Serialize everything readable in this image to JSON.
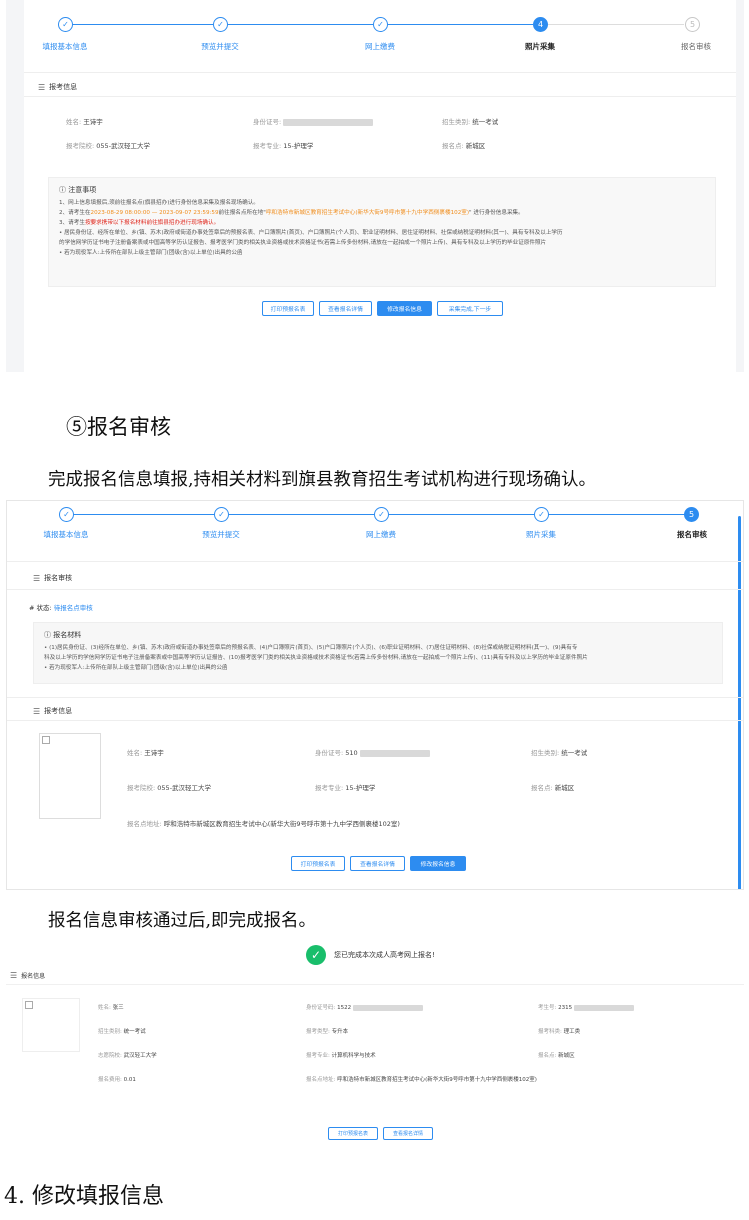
{
  "panel1": {
    "steps": [
      {
        "label": "填报基本信息",
        "state": "done"
      },
      {
        "label": "预览并提交",
        "state": "done"
      },
      {
        "label": "网上缴费",
        "state": "done"
      },
      {
        "label": "照片采集",
        "state": "active",
        "num": "4"
      },
      {
        "label": "报名审核",
        "state": "todo",
        "num": "5"
      }
    ],
    "section_title": "报考信息",
    "fields": {
      "name_label": "姓名:",
      "name_value": "王诗宇",
      "id_label": "身份证号:",
      "type_label": "招生类别:",
      "type_value": "统一考试",
      "school_label": "报考院校:",
      "school_value": "055-武汉轻工大学",
      "major_label": "报考专业:",
      "major_value": "15-护理学",
      "site_label": "报名点:",
      "site_value": "新城区"
    },
    "notice": {
      "title": "注意事项",
      "l1": "1、网上信息填报后,须前往报名点(旗县招办)进行身份信息采集及报名现场确认。",
      "l2a": "2、请考生在",
      "l2_time": "2023-08-29 08:00:00 — 2023-09-07 23:59:59",
      "l2b": "前往报名点所在地\"",
      "l2_place": "呼和浩特市新城区教育招生考试中心(新华大街9号呼市第十九中学西侧裹楼102室)",
      "l2c": "\" 进行身份信息采集。",
      "l3a": "3、请考生",
      "l3_red": "按要求携带以下报名材料前往旗县招办进行现场确认。",
      "l4": "• 居民身份证、经所在单位、乡(镇、苏木)政府或街道办事处签章后的预报名表、户口簿照片(首页)、户口簿照片(个人页)、职业证明材料、居住证明材料、社保或纳税证明材料(其一)、具有专科及以上学历",
      "l5": "的学信网学历证书电子注册备案表或中国高等学历认证报告、报考医学门类的相关执业资格或技术资格证书(若需上传多份材料,请放在一起拍成一个照片上传)、具有专科及以上学历的毕业证原件照片",
      "l6": "• 若为现役军人:上传所在部队上级主管部门(团级(含)以上单位)出具的公函"
    },
    "buttons": [
      "打印预报名表",
      "查看报名详情",
      "修改报名信息",
      "采集完成,下一步"
    ]
  },
  "doc": {
    "h5": "⑤报名审核",
    "p1": "完成报名信息填报,持相关材料到旗县教育招生考试机构进行现场确认。",
    "p2": "报名信息审核通过后,即完成报名。",
    "h4": "4. 修改填报信息"
  },
  "panel2": {
    "steps": [
      {
        "label": "填报基本信息"
      },
      {
        "label": "预览并提交"
      },
      {
        "label": "网上缴费"
      },
      {
        "label": "照片采集"
      },
      {
        "label": "报名审核",
        "num": "5"
      }
    ],
    "audit_title": "报名审核",
    "status_label": "# 状态:",
    "status_value": "待报名点审核",
    "materials_title": "报名材料",
    "m1": "• (1)居民身份证、(3)经所在单位、乡(镇、苏木)政府或街道办事处签章后的预报名表、(4)户口簿照片(首页)、(5)户口簿照片(个人页)、(6)职业证明材料、(7)居住证明材料、(8)社保或纳税证明材料(其一)、(9)具有专",
    "m2": "科及以上学历的学信网学历证书电子注册备案表或中国高等学历认证报告、(10)报考医学门类的相关执业资格或技术资格证书(若需上传多份材料,请放在一起拍成一个照片上传)、(11)具有专科及以上学历的毕业证原件照片",
    "m3": "• 若为现役军人:上传所在部队上级主管部门(团级(含)以上单位)出具的公函",
    "info_title": "报考信息",
    "name_label": "姓名:",
    "name_value": "王诗宇",
    "id_label": "身份证号:",
    "id_value": "510",
    "type_label": "招生类别:",
    "type_value": "统一考试",
    "school_label": "报考院校:",
    "school_value": "055-武汉轻工大学",
    "major_label": "报考专业:",
    "major_value": "15-护理学",
    "site_label": "报名点:",
    "site_value": "新城区",
    "addr_label": "报名点地址:",
    "addr_value": "呼和浩特市新城区教育招生考试中心(新华大街9号呼市第十九中学西侧裹楼102室)",
    "buttons": [
      "打印预报名表",
      "查看报名详情",
      "修改报名信息"
    ]
  },
  "panel3": {
    "success": "您已完成本次成人高考网上报名!",
    "section_title": "报名信息",
    "name_label": "姓名:",
    "name_value": "张三",
    "id_label": "身份证号码:",
    "id_value": "1522",
    "exam_label": "考生号:",
    "exam_value": "2315",
    "type_label": "招生类别:",
    "type_value": "统一考试",
    "level_label": "报考类型:",
    "level_value": "专升本",
    "subject_label": "报考科类:",
    "subject_value": "理工类",
    "school_label": "志愿院校:",
    "school_value": "武汉轻工大学",
    "major_label": "报考专业:",
    "major_value": "计算机科学与技术",
    "site_label": "报名点:",
    "site_value": "新城区",
    "fee_label": "报名费用:",
    "fee_value": "0.01",
    "addr_label": "报名点地址:",
    "addr_value": "呼和浩特市新城区教育招生考试中心(新华大街9号呼市第十九中学西侧裹楼102室)",
    "buttons": [
      "打印预报名表",
      "查看报名详情"
    ]
  }
}
